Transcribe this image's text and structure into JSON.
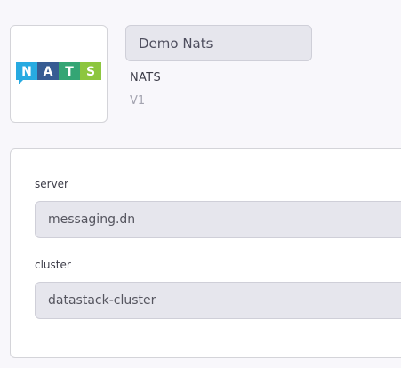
{
  "connector": {
    "name_value": "Demo Nats",
    "logo_icon": "nats-logo",
    "logo_letters": [
      "N",
      "A",
      "T",
      "S"
    ],
    "logo_colors": [
      "#27aae1",
      "#375c93",
      "#34a574",
      "#8dc63f"
    ],
    "type": "NATS",
    "version": "V1"
  },
  "config": {
    "fields": [
      {
        "label": "server",
        "value": "messaging.dn"
      },
      {
        "label": "cluster",
        "value": "datastack-cluster"
      }
    ]
  }
}
